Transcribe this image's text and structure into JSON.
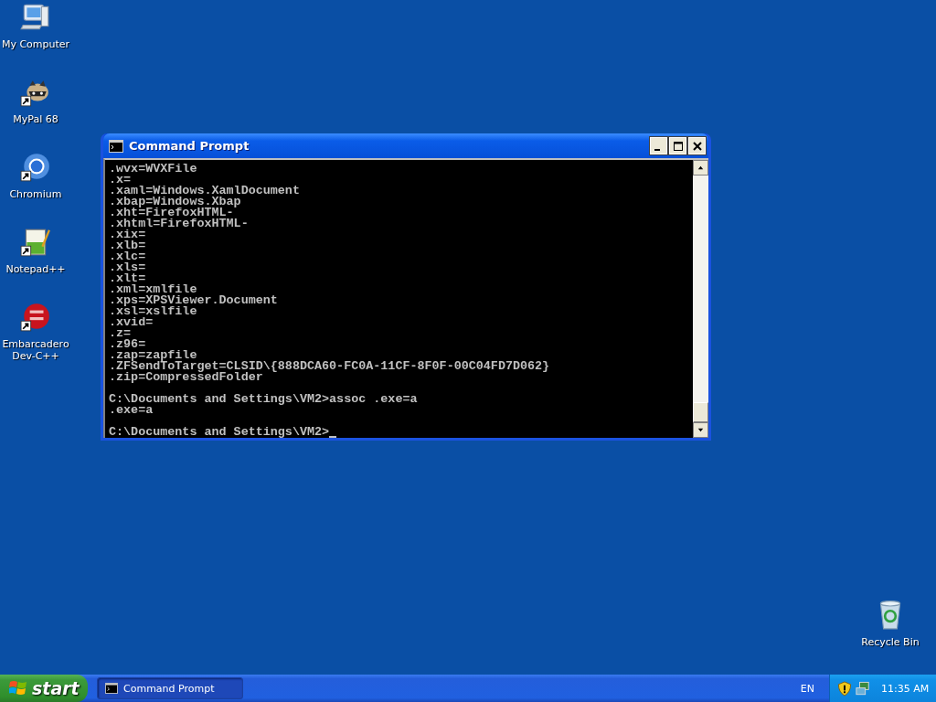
{
  "desktop": {
    "icons": [
      {
        "kind": "computer",
        "label": "My Computer",
        "shortcut": false
      },
      {
        "kind": "raccoon",
        "label": "MyPal 68",
        "shortcut": true
      },
      {
        "kind": "chromium",
        "label": "Chromium",
        "shortcut": true
      },
      {
        "kind": "notepad",
        "label": "Notepad++",
        "shortcut": true
      },
      {
        "kind": "devcpp",
        "label": "Embarcadero Dev-C++",
        "shortcut": true
      },
      {
        "kind": "recycle",
        "label": "Recycle Bin",
        "shortcut": false
      }
    ]
  },
  "window": {
    "title": "Command Prompt",
    "active": true,
    "blocks": [
      [
        ".wvx=WVXFile",
        ".x=",
        ".xaml=Windows.XamlDocument",
        ".xbap=Windows.Xbap",
        ".xht=FirefoxHTML-",
        ".xhtml=FirefoxHTML-",
        ".xix=",
        ".xlb=",
        ".xlc=",
        ".xls=",
        ".xlt=",
        ".xml=xmlfile",
        ".xps=XPSViewer.Document",
        ".xsl=xslfile",
        ".xvid=",
        ".z=",
        ".z96=",
        ".zap=zapfile",
        ".ZFSendToTarget=CLSID\\{888DCA60-FC0A-11CF-8F0F-00C04FD7D062}",
        ".zip=CompressedFolder"
      ],
      [
        "C:\\Documents and Settings\\VM2>assoc .exe=a",
        ".exe=a"
      ],
      [
        "C:\\Documents and Settings\\VM2>"
      ]
    ]
  },
  "taskbar": {
    "start": "start",
    "tasks": [
      {
        "label": "Command Prompt",
        "selected": true
      }
    ],
    "language": "EN",
    "clock": "11:35 AM"
  }
}
